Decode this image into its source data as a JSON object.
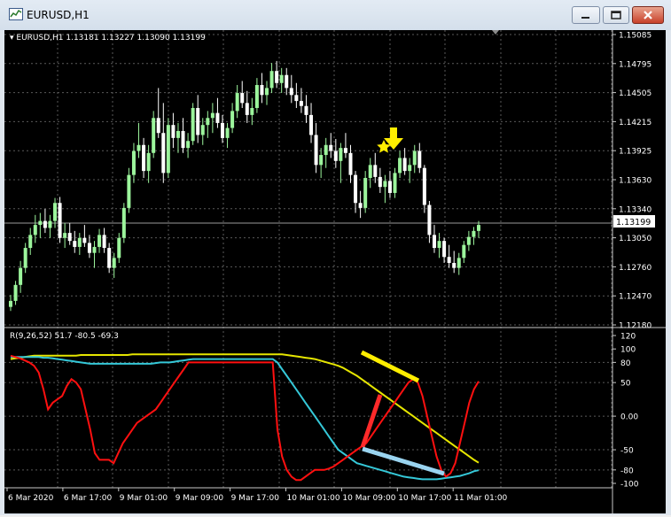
{
  "window": {
    "title": "EURUSD,H1"
  },
  "chart_header": {
    "label": "▾ EURUSD,H1  1.13181 1.13227 1.13090 1.13199"
  },
  "price_axis": {
    "ticks": [
      "1.15085",
      "1.14795",
      "1.14505",
      "1.14215",
      "1.13925",
      "1.13630",
      "1.13340",
      "1.13050",
      "1.12760",
      "1.12470",
      "1.12180"
    ],
    "current_price_label": "1.13199"
  },
  "indicator": {
    "label": "R(9,26,52) 51.7 -80.5 -69.3",
    "ticks": [
      "120",
      "100",
      "80",
      "50",
      "0.00",
      "-50",
      "-80",
      "-100"
    ]
  },
  "time_axis": {
    "labels": [
      "6 Mar 2020",
      "6 Mar 17:00",
      "9 Mar 01:00",
      "9 Mar 09:00",
      "9 Mar 17:00",
      "10 Mar 01:00",
      "10 Mar 09:00",
      "10 Mar 17:00",
      "11 Mar 01:00"
    ]
  },
  "colors": {
    "background": "#000000",
    "bull_candle": "#9cf59c",
    "bear_candle": "#ffffff",
    "grid": "#5a5a5a",
    "fast_line": "#ff1010",
    "medium_line": "#35c8d8",
    "slow_line": "#e6e600",
    "annotation_red": "#ff2a2a",
    "annotation_yellow": "#ffee00",
    "annotation_blue": "#9ad4f0"
  },
  "chart_data": {
    "type": "candlestick",
    "symbol": "EURUSD",
    "timeframe": "H1",
    "price_ylim": [
      1.1218,
      1.15085
    ],
    "candles": [
      [
        1.1236,
        1.1248,
        1.1232,
        1.1242
      ],
      [
        1.1242,
        1.1262,
        1.1238,
        1.1258
      ],
      [
        1.1258,
        1.1282,
        1.125,
        1.1275
      ],
      [
        1.1275,
        1.13,
        1.127,
        1.1295
      ],
      [
        1.1295,
        1.1315,
        1.1288,
        1.1308
      ],
      [
        1.1308,
        1.1328,
        1.13,
        1.1318
      ],
      [
        1.1318,
        1.133,
        1.1305,
        1.1322
      ],
      [
        1.1322,
        1.1334,
        1.131,
        1.1315
      ],
      [
        1.1315,
        1.1328,
        1.1305,
        1.1322
      ],
      [
        1.1322,
        1.1345,
        1.1315,
        1.134
      ],
      [
        1.134,
        1.1346,
        1.13,
        1.1305
      ],
      [
        1.1305,
        1.132,
        1.1295,
        1.131
      ],
      [
        1.131,
        1.132,
        1.1298,
        1.1302
      ],
      [
        1.1302,
        1.1312,
        1.129,
        1.1296
      ],
      [
        1.1296,
        1.131,
        1.1288,
        1.1305
      ],
      [
        1.1305,
        1.1318,
        1.1296,
        1.13
      ],
      [
        1.13,
        1.1308,
        1.1285,
        1.129
      ],
      [
        1.129,
        1.1302,
        1.1275,
        1.1296
      ],
      [
        1.1296,
        1.1314,
        1.129,
        1.1308
      ],
      [
        1.1308,
        1.1315,
        1.129,
        1.1295
      ],
      [
        1.1295,
        1.13,
        1.127,
        1.1275
      ],
      [
        1.1275,
        1.129,
        1.1265,
        1.1285
      ],
      [
        1.1285,
        1.131,
        1.128,
        1.1305
      ],
      [
        1.1305,
        1.134,
        1.13,
        1.1335
      ],
      [
        1.1335,
        1.1375,
        1.133,
        1.1368
      ],
      [
        1.1368,
        1.14,
        1.136,
        1.1392
      ],
      [
        1.1392,
        1.142,
        1.1385,
        1.1398
      ],
      [
        1.1398,
        1.1405,
        1.1365,
        1.1372
      ],
      [
        1.1372,
        1.1398,
        1.136,
        1.139
      ],
      [
        1.139,
        1.1432,
        1.1385,
        1.1425
      ],
      [
        1.1425,
        1.1455,
        1.1405,
        1.141
      ],
      [
        1.141,
        1.144,
        1.136,
        1.137
      ],
      [
        1.137,
        1.1425,
        1.1365,
        1.1418
      ],
      [
        1.1418,
        1.143,
        1.1395,
        1.1405
      ],
      [
        1.1405,
        1.142,
        1.139,
        1.1412
      ],
      [
        1.1412,
        1.1425,
        1.139,
        1.1395
      ],
      [
        1.1395,
        1.141,
        1.1385,
        1.1402
      ],
      [
        1.1402,
        1.144,
        1.1398,
        1.1435
      ],
      [
        1.1435,
        1.1448,
        1.14,
        1.1408
      ],
      [
        1.1408,
        1.1425,
        1.1398,
        1.1418
      ],
      [
        1.1418,
        1.1432,
        1.1405,
        1.1425
      ],
      [
        1.1425,
        1.144,
        1.141,
        1.143
      ],
      [
        1.143,
        1.1445,
        1.1415,
        1.142
      ],
      [
        1.142,
        1.1428,
        1.14,
        1.1405
      ],
      [
        1.1405,
        1.142,
        1.1395,
        1.1415
      ],
      [
        1.1415,
        1.144,
        1.141,
        1.1432
      ],
      [
        1.1432,
        1.1458,
        1.1425,
        1.145
      ],
      [
        1.145,
        1.1462,
        1.1435,
        1.144
      ],
      [
        1.144,
        1.1452,
        1.142,
        1.1428
      ],
      [
        1.1428,
        1.1445,
        1.1418,
        1.1435
      ],
      [
        1.1435,
        1.1465,
        1.143,
        1.1458
      ],
      [
        1.1458,
        1.147,
        1.144,
        1.1448
      ],
      [
        1.1448,
        1.1462,
        1.1438,
        1.1455
      ],
      [
        1.1455,
        1.148,
        1.145,
        1.1472
      ],
      [
        1.1472,
        1.1482,
        1.1455,
        1.146
      ],
      [
        1.146,
        1.1475,
        1.145,
        1.1468
      ],
      [
        1.1468,
        1.1475,
        1.1448,
        1.1455
      ],
      [
        1.1455,
        1.1468,
        1.144,
        1.1448
      ],
      [
        1.1448,
        1.146,
        1.1435,
        1.1442
      ],
      [
        1.1442,
        1.1455,
        1.143,
        1.1437
      ],
      [
        1.1437,
        1.1448,
        1.142,
        1.1428
      ],
      [
        1.1428,
        1.144,
        1.14,
        1.1408
      ],
      [
        1.1408,
        1.142,
        1.137,
        1.1378
      ],
      [
        1.1378,
        1.1395,
        1.1365,
        1.1388
      ],
      [
        1.1388,
        1.1405,
        1.1375,
        1.1398
      ],
      [
        1.1398,
        1.141,
        1.1385,
        1.1392
      ],
      [
        1.1392,
        1.1404,
        1.1375,
        1.1382
      ],
      [
        1.1382,
        1.14,
        1.136,
        1.1395
      ],
      [
        1.1395,
        1.141,
        1.1385,
        1.139
      ],
      [
        1.139,
        1.1398,
        1.136,
        1.1368
      ],
      [
        1.1368,
        1.1372,
        1.133,
        1.134
      ],
      [
        1.134,
        1.1352,
        1.1325,
        1.1335
      ],
      [
        1.1335,
        1.1372,
        1.133,
        1.1365
      ],
      [
        1.1365,
        1.1385,
        1.1355,
        1.1378
      ],
      [
        1.1378,
        1.139,
        1.136,
        1.1366
      ],
      [
        1.1366,
        1.1375,
        1.135,
        1.1356
      ],
      [
        1.1356,
        1.1368,
        1.134,
        1.1362
      ],
      [
        1.1362,
        1.1372,
        1.1345,
        1.135
      ],
      [
        1.135,
        1.1375,
        1.1345,
        1.137
      ],
      [
        1.137,
        1.1392,
        1.1365,
        1.1385
      ],
      [
        1.1385,
        1.1395,
        1.1368,
        1.1372
      ],
      [
        1.1372,
        1.1385,
        1.136,
        1.1378
      ],
      [
        1.1378,
        1.1398,
        1.137,
        1.1392
      ],
      [
        1.1392,
        1.14,
        1.137,
        1.1375
      ],
      [
        1.1375,
        1.1378,
        1.133,
        1.1338
      ],
      [
        1.1338,
        1.1342,
        1.13,
        1.1308
      ],
      [
        1.1308,
        1.1318,
        1.129,
        1.1295
      ],
      [
        1.1295,
        1.131,
        1.1285,
        1.1302
      ],
      [
        1.1302,
        1.1305,
        1.128,
        1.1286
      ],
      [
        1.1286,
        1.1298,
        1.1275,
        1.128
      ],
      [
        1.128,
        1.1292,
        1.127,
        1.1275
      ],
      [
        1.1275,
        1.129,
        1.1268,
        1.1285
      ],
      [
        1.1285,
        1.1302,
        1.128,
        1.1298
      ],
      [
        1.1298,
        1.1312,
        1.1292,
        1.1306
      ],
      [
        1.1306,
        1.1316,
        1.1298,
        1.1312
      ],
      [
        1.1312,
        1.1322,
        1.1305,
        1.1318
      ]
    ],
    "current_price": 1.13199,
    "indicator_ylim": [
      -100,
      120
    ],
    "indicator_series": [
      {
        "values": [
          90,
          88,
          86,
          83,
          80,
          75,
          65,
          40,
          10,
          20,
          25,
          30,
          45,
          55,
          50,
          40,
          10,
          -20,
          -55,
          -65,
          -65,
          -65,
          -70,
          -55,
          -40,
          -30,
          -20,
          -10,
          -5,
          0,
          5,
          10,
          20,
          30,
          40,
          50,
          60,
          70,
          80,
          80,
          80,
          80,
          80,
          80,
          80,
          80,
          80,
          80,
          80,
          80,
          80,
          80,
          80,
          80,
          80,
          80,
          80,
          -20,
          -60,
          -80,
          -90,
          -95,
          -95,
          -90,
          -85,
          -80,
          -80,
          -80,
          -78,
          -75,
          -70,
          -65,
          -60,
          -55,
          -50,
          -45,
          -40,
          -30,
          -20,
          -10,
          0,
          10,
          20,
          30,
          40,
          50,
          55,
          50,
          30,
          0,
          -30,
          -60,
          -80,
          -90,
          -85,
          -70,
          -40,
          -10,
          20,
          40,
          51.7
        ]
      },
      {
        "values": [
          88,
          88,
          88,
          88,
          88,
          88,
          88,
          87,
          87,
          86,
          85,
          84,
          83,
          82,
          81,
          80,
          79,
          78,
          78,
          78,
          78,
          78,
          78,
          78,
          78,
          78,
          78,
          78,
          78,
          78,
          78,
          79,
          80,
          80,
          80,
          81,
          82,
          83,
          84,
          85,
          85,
          85,
          85,
          85,
          85,
          85,
          85,
          85,
          85,
          85,
          85,
          85,
          85,
          85,
          85,
          85,
          85,
          80,
          70,
          60,
          50,
          40,
          30,
          20,
          10,
          0,
          -10,
          -20,
          -30,
          -40,
          -50,
          -55,
          -60,
          -65,
          -70,
          -72,
          -74,
          -76,
          -78,
          -80,
          -82,
          -84,
          -86,
          -88,
          -90,
          -91,
          -92,
          -93,
          -94,
          -94,
          -94,
          -94,
          -93,
          -92,
          -91,
          -90,
          -89,
          -87,
          -85,
          -82,
          -80.5
        ]
      },
      {
        "values": [
          85,
          86,
          87,
          88,
          89,
          90,
          90,
          90,
          90,
          90,
          90,
          90,
          90,
          90,
          90,
          91,
          91,
          91,
          91,
          91,
          91,
          91,
          91,
          91,
          91,
          91,
          92,
          92,
          92,
          92,
          92,
          92,
          92,
          92,
          92,
          92,
          92,
          92,
          92,
          92,
          92,
          92,
          92,
          92,
          92,
          92,
          92,
          92,
          92,
          92,
          92,
          92,
          92,
          92,
          92,
          92,
          92,
          92,
          92,
          91,
          90,
          89,
          88,
          87,
          86,
          85,
          83,
          81,
          79,
          77,
          75,
          72,
          68,
          64,
          60,
          55,
          50,
          45,
          40,
          35,
          30,
          25,
          20,
          15,
          10,
          5,
          0,
          -5,
          -10,
          -15,
          -20,
          -25,
          -30,
          -35,
          -40,
          -45,
          -50,
          -55,
          -60,
          -65,
          -69.3
        ]
      }
    ]
  }
}
